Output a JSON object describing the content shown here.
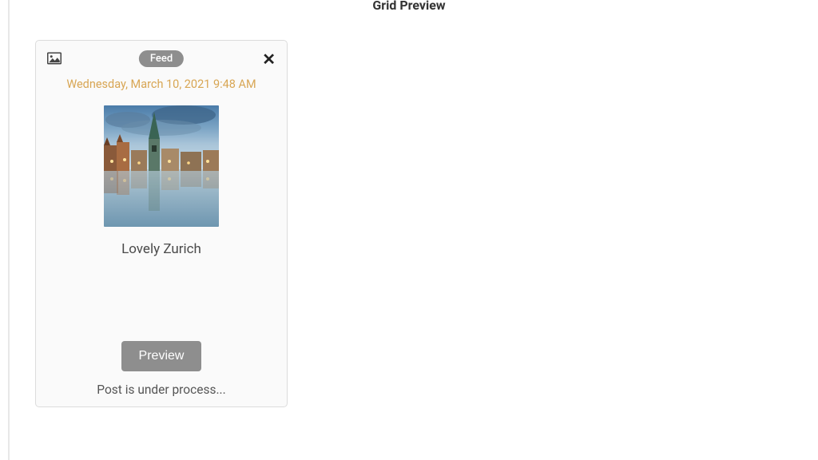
{
  "page": {
    "header": "Grid Preview"
  },
  "card": {
    "badge": "Feed",
    "timestamp": "Wednesday, March 10, 2021 9:48 AM",
    "caption": "Lovely Zurich",
    "preview_button": "Preview",
    "status": "Post is under process...",
    "type_icon": "image-icon",
    "close_icon": "close-icon"
  }
}
